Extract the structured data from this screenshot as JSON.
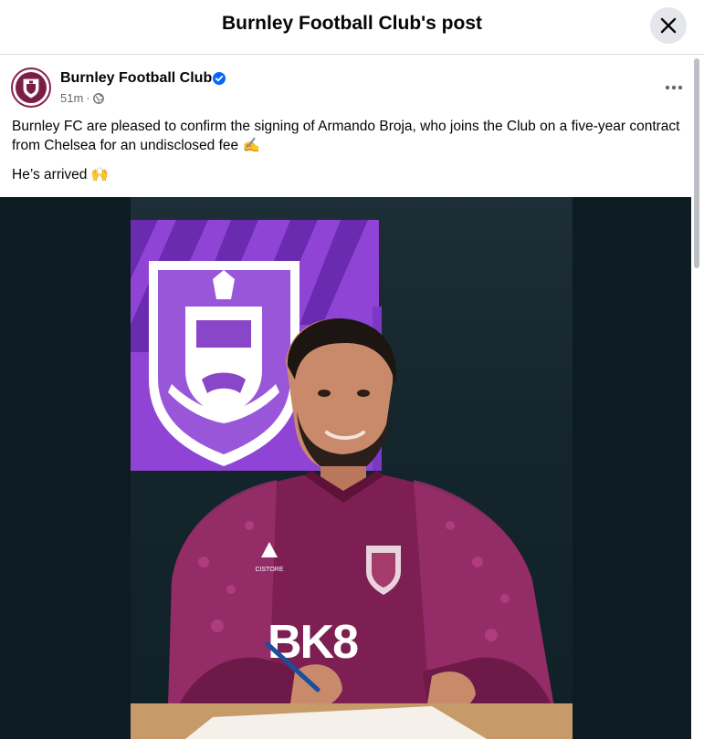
{
  "dialog": {
    "title": "Burnley Football Club's post",
    "close_icon": "close-icon"
  },
  "post": {
    "author": "Burnley Football Club",
    "verified_icon": "verified-badge-icon",
    "timestamp": "51m",
    "separator": "·",
    "audience_icon": "globe-icon",
    "more_icon": "more-options-icon",
    "text_line_1": "Burnley FC are pleased to confirm the signing of Armando Broja, who joins the Club on a five-year contract from Chelsea for an undisclosed fee ✍️",
    "text_line_2": "He’s arrived 🙌"
  },
  "photo": {
    "sponsor_text": "BK8",
    "kit_brand_text": "CISTORE"
  },
  "colors": {
    "club_claret": "#7a1e48",
    "club_purple": "#a14fe0",
    "verified_blue": "#0866ff",
    "meta_gray": "#65676b",
    "background_dark": "#0c1c22"
  }
}
